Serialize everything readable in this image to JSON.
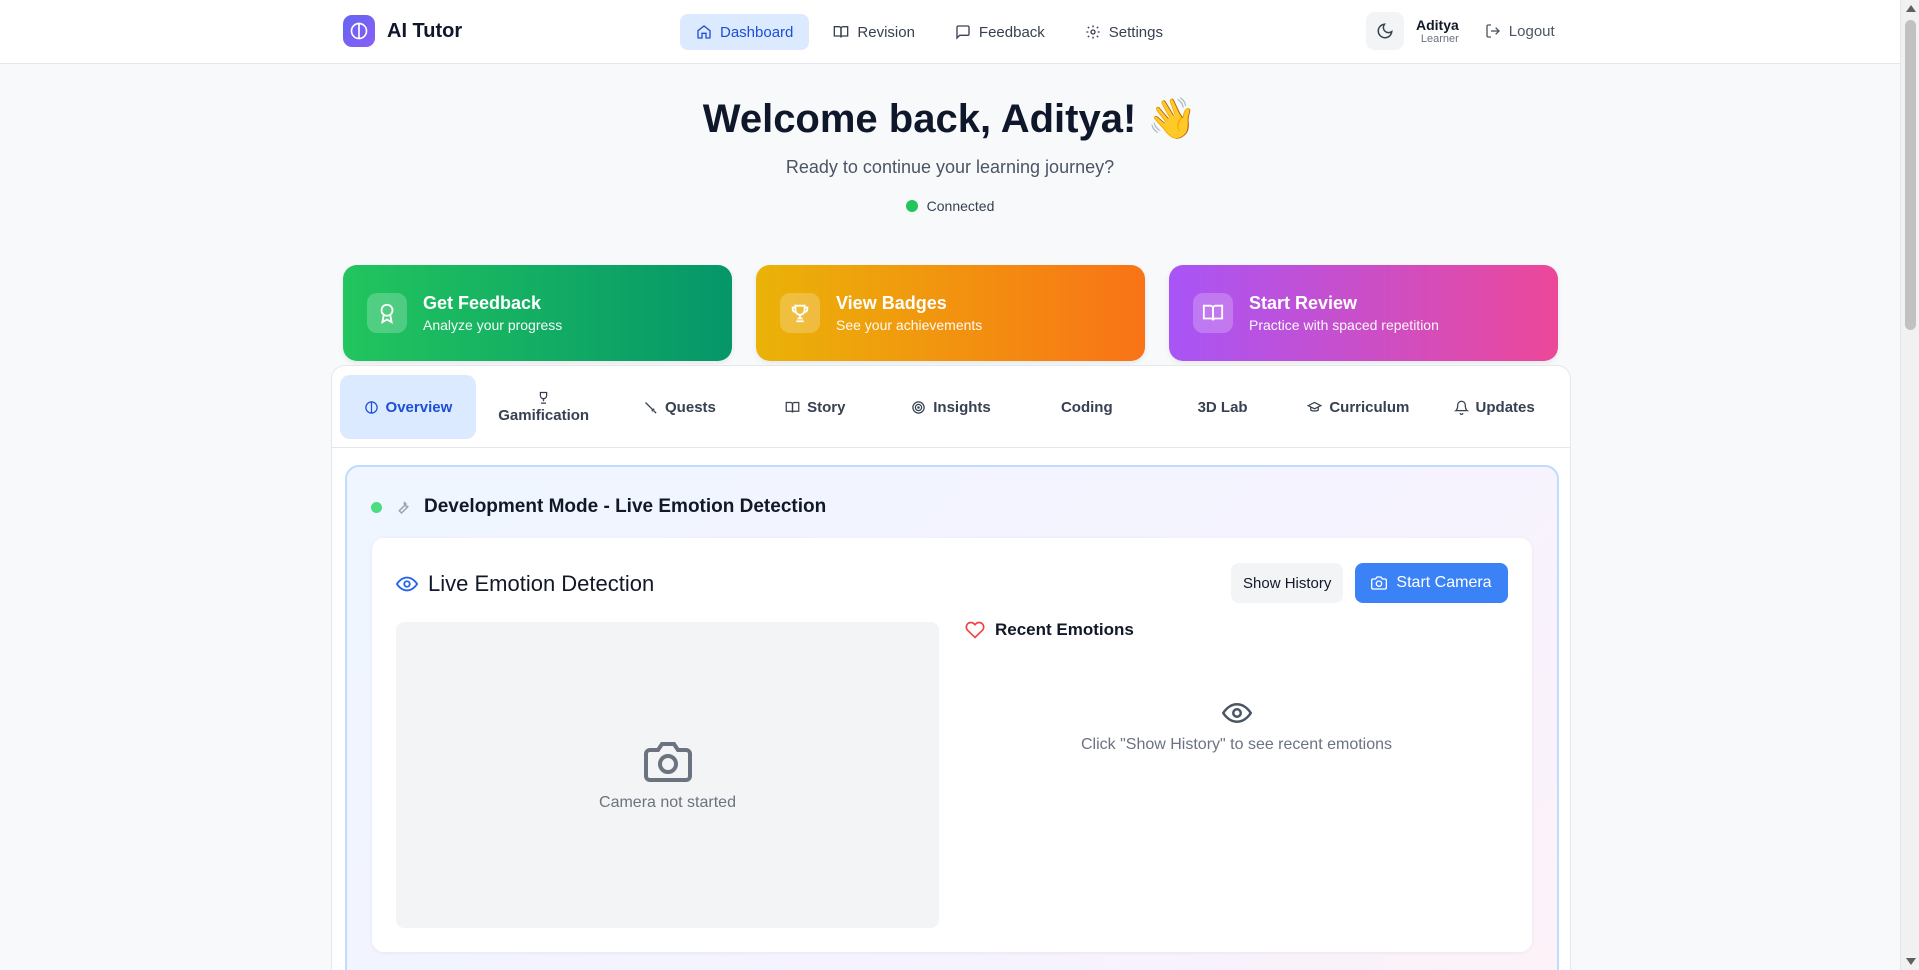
{
  "brand": {
    "name": "AI Tutor"
  },
  "nav": {
    "items": [
      {
        "label": "Dashboard",
        "icon": "home-icon",
        "active": true
      },
      {
        "label": "Revision",
        "icon": "book-icon",
        "active": false
      },
      {
        "label": "Feedback",
        "icon": "message-icon",
        "active": false
      },
      {
        "label": "Settings",
        "icon": "gear-icon",
        "active": false
      }
    ]
  },
  "user": {
    "name": "Aditya",
    "role": "Learner",
    "logout_label": "Logout"
  },
  "hero": {
    "title": "Welcome back, Aditya! 👋",
    "subtitle": "Ready to continue your learning journey?",
    "status": "Connected",
    "status_color": "#22c55e"
  },
  "actions": [
    {
      "title": "Get Feedback",
      "subtitle": "Analyze your progress",
      "icon": "award-icon"
    },
    {
      "title": "View Badges",
      "subtitle": "See your achievements",
      "icon": "trophy-icon"
    },
    {
      "title": "Start Review",
      "subtitle": "Practice with spaced repetition",
      "icon": "book-open-icon"
    }
  ],
  "tabs": [
    {
      "label": "Overview",
      "icon": "brain-icon",
      "active": true
    },
    {
      "label": "Gamification",
      "icon": "trophy-icon",
      "active": false
    },
    {
      "label": "Quests",
      "icon": "sword-icon",
      "active": false
    },
    {
      "label": "Story",
      "icon": "book-icon",
      "active": false
    },
    {
      "label": "Insights",
      "icon": "target-icon",
      "active": false
    },
    {
      "label": "Coding",
      "icon": "",
      "active": false
    },
    {
      "label": "3D Lab",
      "icon": "",
      "active": false
    },
    {
      "label": "Curriculum",
      "icon": "graduation-cap-icon",
      "active": false
    },
    {
      "label": "Updates",
      "icon": "bell-icon",
      "active": false
    }
  ],
  "dev_mode": {
    "title": "Development Mode - Live Emotion Detection",
    "icon": "wrench-icon"
  },
  "emotion": {
    "title": "Live Emotion Detection",
    "show_history_label": "Show History",
    "start_camera_label": "Start Camera",
    "camera_status": "Camera not started",
    "recent_title": "Recent Emotions",
    "recent_empty": "Click \"Show History\" to see recent emotions"
  },
  "colors": {
    "accent": "#3b82f6",
    "active_bg": "#dbeafe",
    "card_green": "#10b981",
    "card_orange": "#f59e0b",
    "card_pink": "#d946ef"
  }
}
